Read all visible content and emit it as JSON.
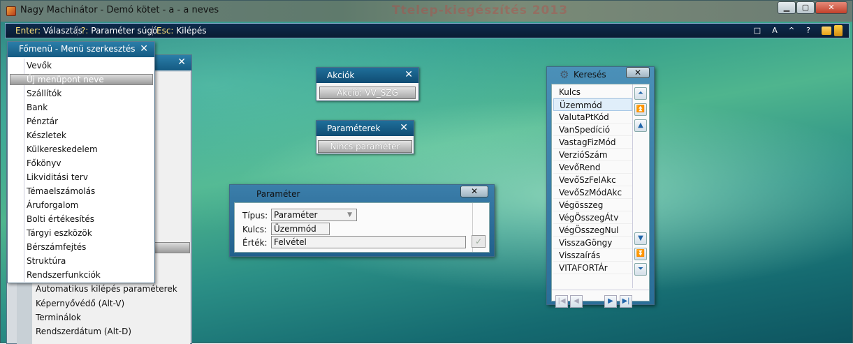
{
  "window": {
    "title": "Nagy Machinátor - Demó kötet - a - a neves",
    "ghost_text": "Ttelep-kiegészítés 2013"
  },
  "toolbar": {
    "hints": [
      {
        "key": "Enter:",
        "label": "Választás"
      },
      {
        "key": "?:",
        "label": "Paraméter súgó"
      },
      {
        "key": "Esc:",
        "label": "Kilépés"
      }
    ],
    "icons": [
      "□",
      "A",
      "^",
      "?"
    ]
  },
  "menu": {
    "title": "Főmenü - Menü szerkesztés",
    "items": [
      "Vevők",
      "Új menüpont neve",
      "Szállítók",
      "Bank",
      "Pénztár",
      "Készletek",
      "Külkereskedelem",
      "Főkönyv",
      "Likviditási terv",
      "Témaelszámolás",
      "Áruforgalom",
      "Bolti értékesítés",
      "Tárgyi eszközök",
      "Bérszámfejtés",
      "Struktúra",
      "Rendszerfunkciók"
    ],
    "selected_index": 1
  },
  "back_menu": {
    "items": [
      "Automatikus kilépés paraméterek",
      "Képernyővédő (Alt-V)",
      "Terminálok",
      "Rendszerdátum (Alt-D)"
    ]
  },
  "akcio": {
    "title": "Akciók",
    "field": "Akció:      VV_SZG"
  },
  "parameterek": {
    "title": "Paraméterek",
    "field": "Nincs paraméter"
  },
  "parameter_dialog": {
    "title": "Paraméter",
    "tipus_label": "Típus:",
    "tipus_value": "Paraméter",
    "kulcs_label": "Kulcs:",
    "kulcs_value": "Üzemmód",
    "ertek_label": "Érték:",
    "ertek_value": "Felvétel"
  },
  "search": {
    "title": "Keresés",
    "items": [
      "Kulcs",
      "Üzemmód",
      "ValutaPtKód",
      "VanSpedíció",
      "VastagFizMód",
      "VerzióSzám",
      "VevőRend",
      "VevőSzFelAkc",
      "VevőSzMódAkc",
      "Végösszeg",
      "VégÖsszegÁtv",
      "VégÖsszegNul",
      "VisszaGöngy",
      "Visszaírás",
      "VITAFORTÁr"
    ],
    "selected_index": 1
  }
}
